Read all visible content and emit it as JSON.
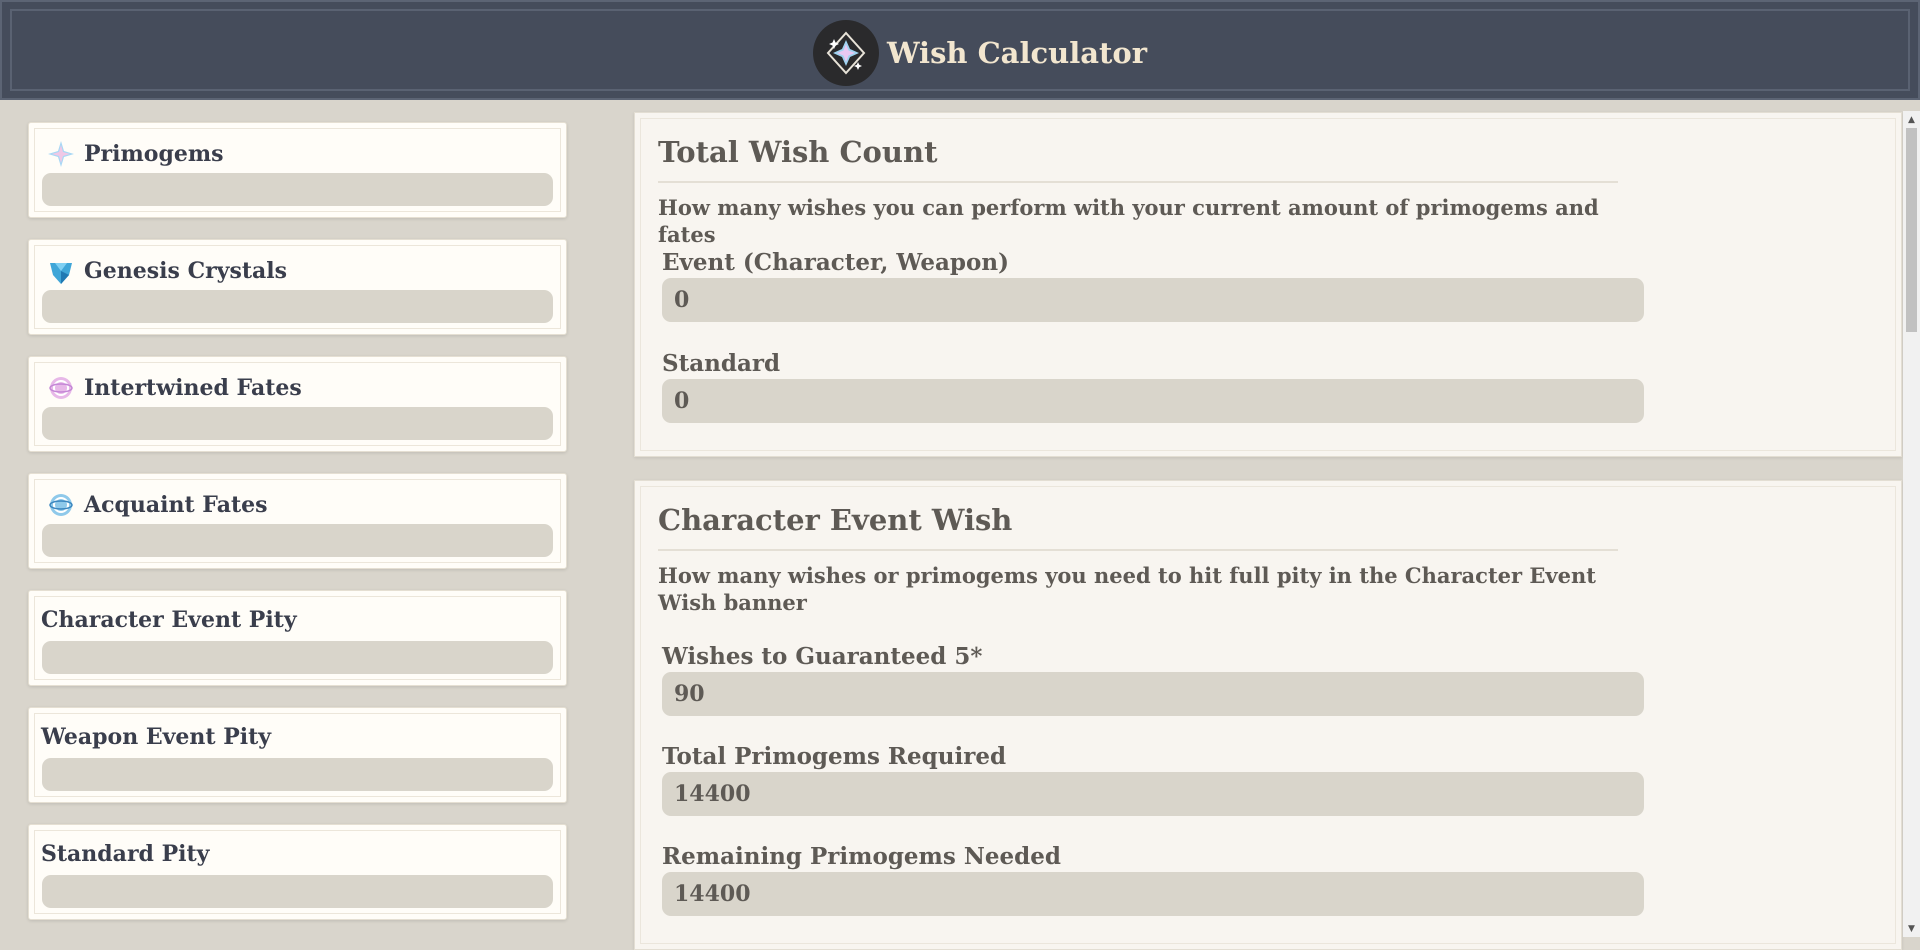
{
  "header": {
    "title": "Wish Calculator",
    "logo_icon": "sparkle-star-icon"
  },
  "inputs": [
    {
      "label": "Primogems",
      "icon": "primogem-icon",
      "value": ""
    },
    {
      "label": "Genesis Crystals",
      "icon": "genesis-crystal-icon",
      "value": ""
    },
    {
      "label": "Intertwined Fates",
      "icon": "intertwined-fate-icon",
      "value": ""
    },
    {
      "label": "Acquaint Fates",
      "icon": "acquaint-fate-icon",
      "value": ""
    },
    {
      "label": "Character Event Pity",
      "value": ""
    },
    {
      "label": "Weapon Event Pity",
      "value": ""
    },
    {
      "label": "Standard Pity",
      "value": ""
    }
  ],
  "total_wish_count": {
    "title": "Total Wish Count",
    "description": "How many wishes you can perform with your current amount of primogems and fates",
    "fields": [
      {
        "label": "Event (Character, Weapon)",
        "value": "0"
      },
      {
        "label": "Standard",
        "value": "0"
      }
    ]
  },
  "character_event_wish": {
    "title": "Character Event Wish",
    "description": "How many wishes or primogems you need to hit full pity in the Character Event Wish banner",
    "fields": [
      {
        "label": "Wishes to Guaranteed 5*",
        "value": "90"
      },
      {
        "label": "Total Primogems Required",
        "value": "14400"
      },
      {
        "label": "Remaining Primogems Needed",
        "value": "14400"
      }
    ]
  },
  "colors": {
    "header_bg": "#454c5b",
    "title_text": "#f2e6cf",
    "page_bg": "#d9d5cc",
    "input_bg": "#d9d5cb"
  }
}
